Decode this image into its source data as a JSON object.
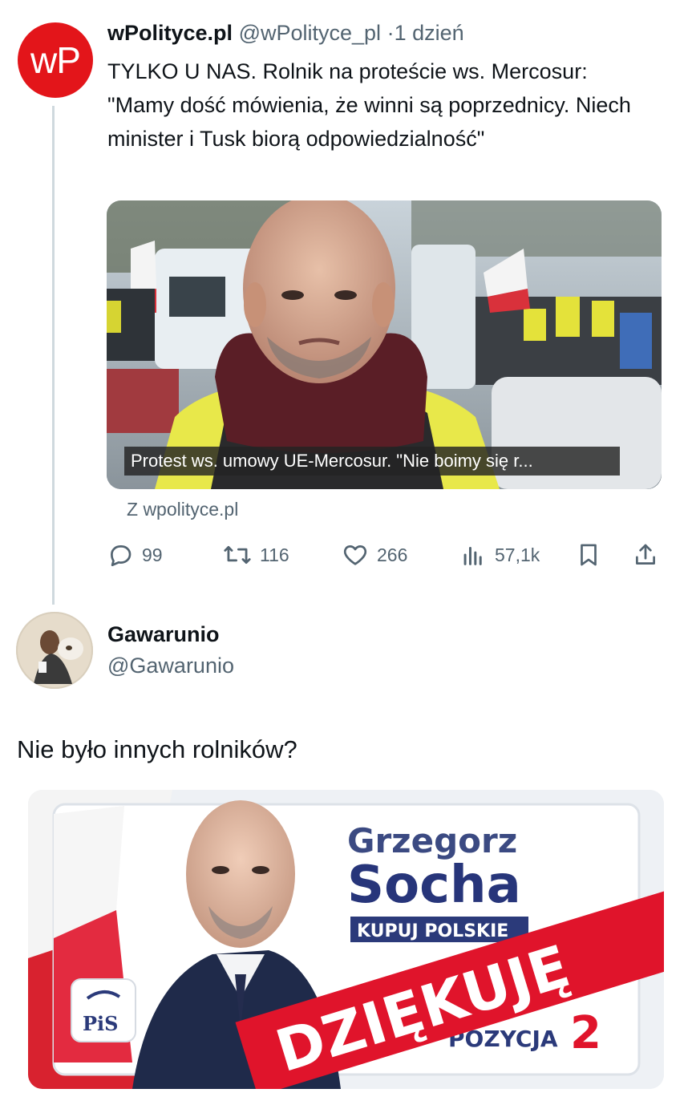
{
  "tweet1": {
    "avatar_text": "wP",
    "author_name": "wPolityce.pl",
    "author_handle": "@wPolityce_pl",
    "separator": "·",
    "time": "1 dzień",
    "text": "TYLKO U NAS. Rolnik na proteście ws. Mercosur: \"Mamy dość mówienia, że winni są poprzednicy. Niech minister i Tusk biorą odpowiedzialność\"",
    "video_caption": "Protest ws. umowy UE-Mercosur. \"Nie boimy się r...",
    "source": "Z wpolityce.pl",
    "stats": {
      "replies": "99",
      "reposts": "116",
      "likes": "266",
      "views": "57,1k"
    }
  },
  "tweet2": {
    "author_name": "Gawarunio",
    "author_handle": "@Gawarunio",
    "text": "Nie było innych rolników?",
    "poster": {
      "first_name": "Grzegorz",
      "last_name": "Socha",
      "slogan": "KUPUJ POLSKIE",
      "party_logo": "PiS",
      "position_label": "POZYCJA",
      "position_number": "2",
      "banner_text": "DZIĘKUJĘ"
    }
  },
  "colors": {
    "text_primary": "#0f1419",
    "text_secondary": "#536471",
    "wp_red": "#e3151a",
    "thread_line": "#cfd9de",
    "poster_navy": "#2b3a7a",
    "poster_red": "#e0142b"
  },
  "icons": [
    "reply-icon",
    "repost-icon",
    "like-icon",
    "views-icon",
    "bookmark-icon",
    "share-icon"
  ]
}
